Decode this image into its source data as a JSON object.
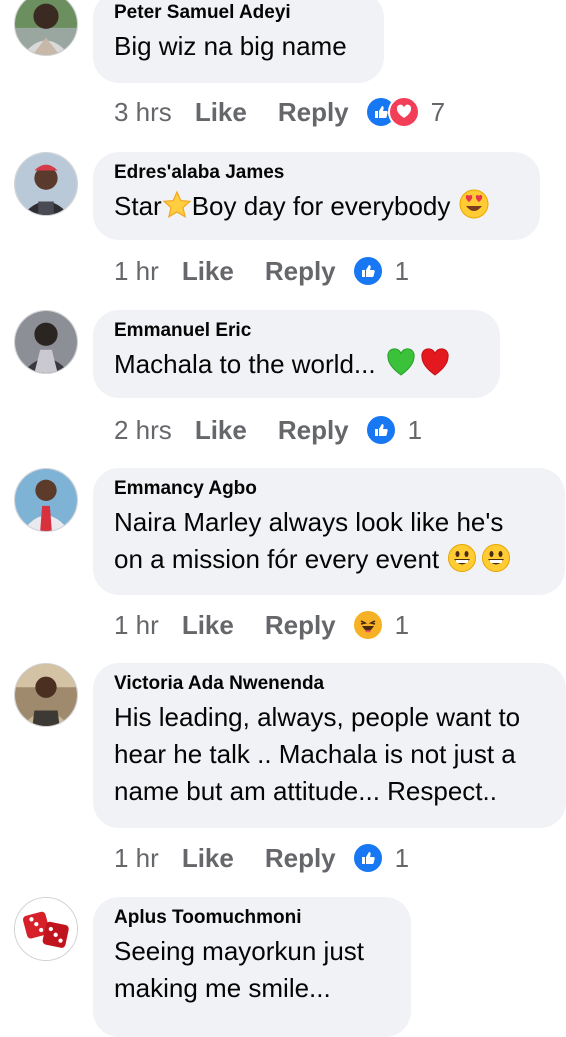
{
  "comments": [
    {
      "author": "Peter Samuel Adeyi",
      "text": "Big wiz na big name",
      "emojis": [],
      "time": "3 hrs",
      "like_label": "Like",
      "reply_label": "Reply",
      "reactions": [
        "like",
        "love"
      ],
      "reaction_count": "7"
    },
    {
      "author": "Edres'alaba James",
      "text_parts": [
        "Star",
        "Boy day for everybody"
      ],
      "emojis": [
        "star",
        "heart-eyes"
      ],
      "time": "1 hr",
      "like_label": "Like",
      "reply_label": "Reply",
      "reactions": [
        "like"
      ],
      "reaction_count": "1"
    },
    {
      "author": "Emmanuel Eric",
      "text": "Machala to the world...",
      "emojis": [
        "green-heart",
        "red-heart"
      ],
      "time": "2 hrs",
      "like_label": "Like",
      "reply_label": "Reply",
      "reactions": [
        "like"
      ],
      "reaction_count": "1"
    },
    {
      "author": "Emmancy Agbo",
      "text_lines": [
        "Naira Marley always look like he's",
        "on a mission fór every event"
      ],
      "emojis": [
        "grinning",
        "grinning"
      ],
      "time": "1 hr",
      "like_label": "Like",
      "reply_label": "Reply",
      "reactions": [
        "haha"
      ],
      "reaction_count": "1"
    },
    {
      "author": "Victoria Ada Nwenenda",
      "text_lines": [
        "His leading, always, people want to",
        "hear he talk .. Machala is not just a",
        "name but am attitude... Respect.."
      ],
      "emojis": [],
      "time": "1 hr",
      "like_label": "Like",
      "reply_label": "Reply",
      "reactions": [
        "like"
      ],
      "reaction_count": "1"
    },
    {
      "author": "Aplus Toomuchmoni",
      "text_lines": [
        "Seeing mayorkun just",
        "making me smile..."
      ],
      "emojis": []
    }
  ],
  "colors": {
    "bubble_bg": "#f0f2f5",
    "meta_text": "#65676b",
    "like_blue": "#1877f2",
    "love_red": "#f33e58",
    "haha_yellow": "#f7b125"
  },
  "icons": {
    "like": "like-reaction-icon",
    "love": "love-reaction-icon",
    "haha": "haha-reaction-icon"
  }
}
